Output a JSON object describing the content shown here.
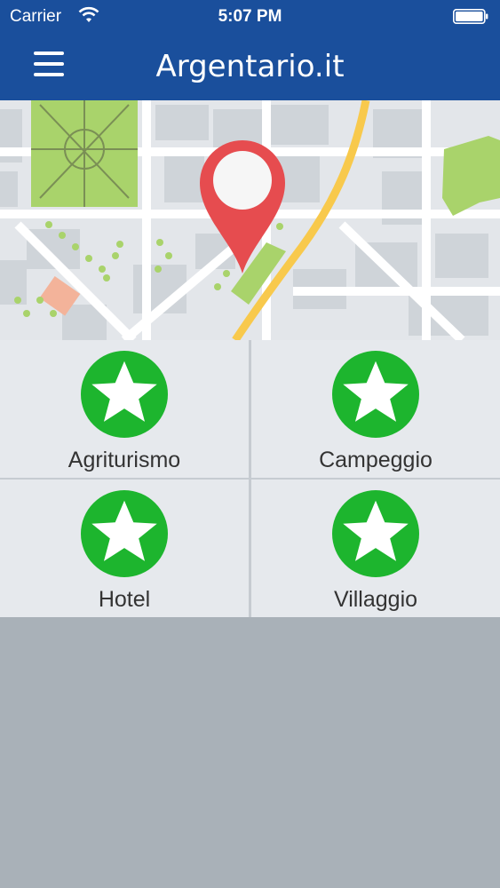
{
  "status_bar": {
    "carrier": "Carrier",
    "time": "5:07 PM",
    "wifi_icon": "wifi-icon",
    "battery_icon": "battery-icon"
  },
  "nav": {
    "title": "Argentario.it",
    "menu_icon": "hamburger-menu-icon"
  },
  "colors": {
    "nav_bg": "#1a4f9c",
    "badge_green": "#1db52e",
    "map_pin": "#e64c4f",
    "road": "#f8c94c",
    "park": "#a9d36b"
  },
  "categories": [
    {
      "label": "Agriturismo",
      "icon": "star-icon"
    },
    {
      "label": "Campeggio",
      "icon": "star-icon"
    },
    {
      "label": "Hotel",
      "icon": "star-icon"
    },
    {
      "label": "Villaggio",
      "icon": "star-icon"
    }
  ]
}
